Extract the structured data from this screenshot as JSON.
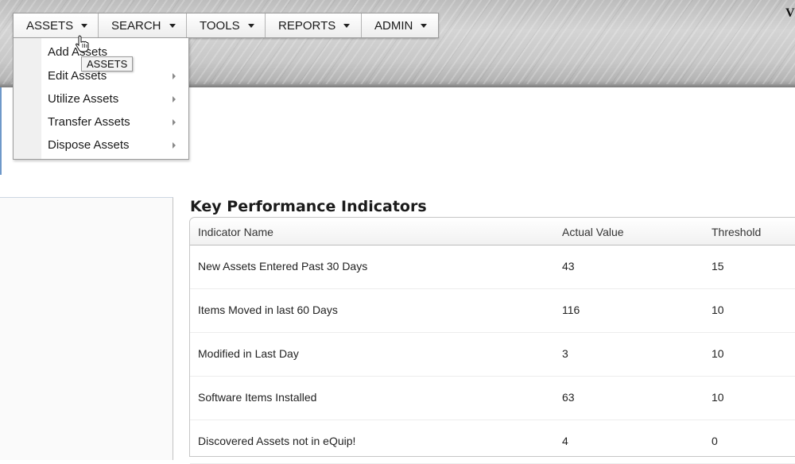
{
  "colors": {
    "header_band": "#c6c6c6",
    "left_border_accent": "#6e98c9"
  },
  "header": {
    "brand_edge_text": "V"
  },
  "menubar": {
    "items": [
      {
        "label": "ASSETS"
      },
      {
        "label": "SEARCH"
      },
      {
        "label": "TOOLS"
      },
      {
        "label": "REPORTS"
      },
      {
        "label": "ADMIN"
      }
    ]
  },
  "assets_menu": {
    "items": [
      {
        "label": "Add Assets",
        "has_submenu": false
      },
      {
        "label": "Edit Assets",
        "has_submenu": true
      },
      {
        "label": "Utilize Assets",
        "has_submenu": true
      },
      {
        "label": "Transfer Assets",
        "has_submenu": true
      },
      {
        "label": "Dispose Assets",
        "has_submenu": true
      }
    ],
    "tooltip": "ASSETS"
  },
  "kpi": {
    "title": "Key Performance Indicators",
    "columns": [
      "Indicator Name",
      "Actual Value",
      "Threshold"
    ],
    "rows": [
      {
        "name": "New Assets Entered Past 30 Days",
        "actual": "43",
        "threshold": "15"
      },
      {
        "name": "Items Moved in last 60 Days",
        "actual": "116",
        "threshold": "10"
      },
      {
        "name": "Modified in Last Day",
        "actual": "3",
        "threshold": "10"
      },
      {
        "name": "Software Items Installed",
        "actual": "63",
        "threshold": "10"
      },
      {
        "name": "Discovered Assets not in eQuip!",
        "actual": "4",
        "threshold": "0"
      }
    ]
  }
}
